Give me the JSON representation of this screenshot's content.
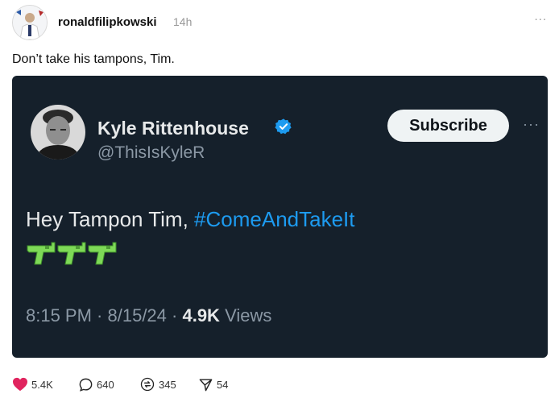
{
  "post": {
    "username": "ronaldfilipkowski",
    "time": "14h",
    "more": "...",
    "caption": "Don’t take his tampons, Tim."
  },
  "tweet": {
    "name": "Kyle Rittenhouse",
    "handle": "@ThisIsKyleR",
    "subscribe_label": "Subscribe",
    "more": "···",
    "text_prefix": "Hey Tampon Tim, ",
    "hashtag": "#ComeAndTakeIt",
    "emoji_icons": [
      "water-pistol-icon",
      "water-pistol-icon",
      "water-pistol-icon"
    ],
    "time": "8:15 PM",
    "sep": " · ",
    "date": "8/15/24",
    "views_count": "4.9K",
    "views_label": " Views",
    "colors": {
      "background": "#15202b",
      "accent": "#1d9bf0",
      "gun": "#7ed957"
    }
  },
  "actions": {
    "likes": "5.4K",
    "replies": "640",
    "reposts": "345",
    "shares": "54",
    "colors": {
      "like": "#e0245e"
    }
  }
}
